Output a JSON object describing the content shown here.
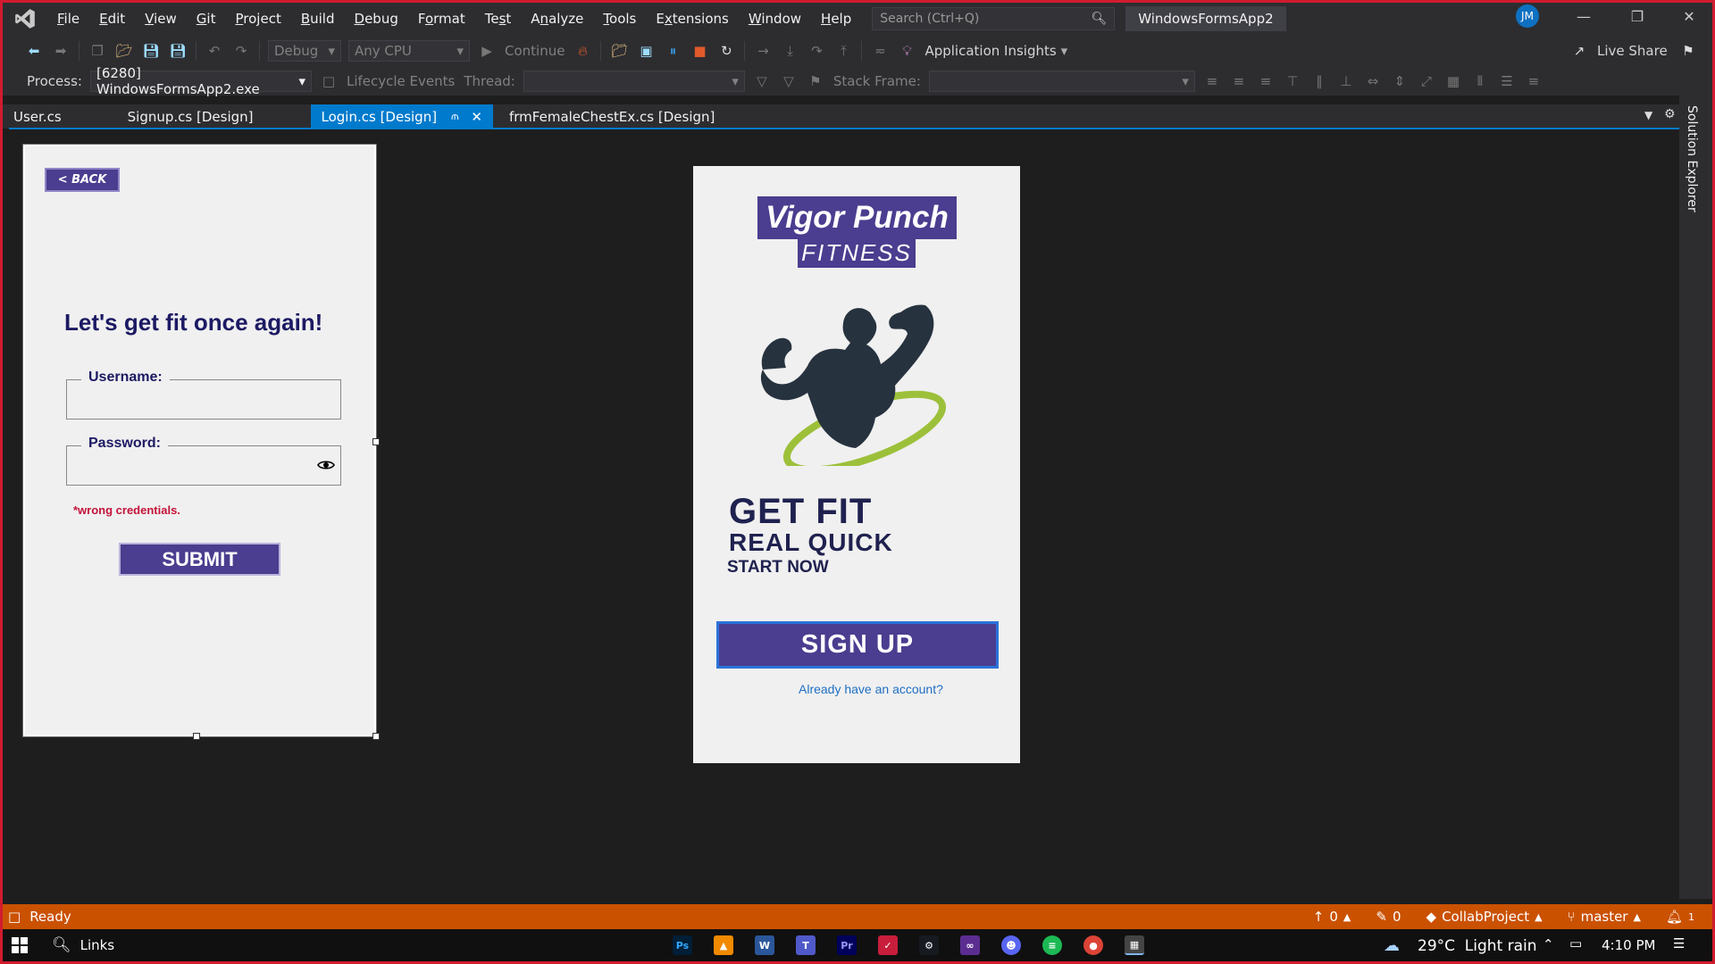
{
  "menubar": {
    "items": [
      "File",
      "Edit",
      "View",
      "Git",
      "Project",
      "Build",
      "Debug",
      "Format",
      "Test",
      "Analyze",
      "Tools",
      "Extensions",
      "Window",
      "Help"
    ],
    "underline": [
      "F",
      "E",
      "V",
      "G",
      "P",
      "B",
      "D",
      "o",
      "s",
      "n",
      "T",
      "x",
      "W",
      "H"
    ],
    "search_placeholder": "Search (Ctrl+Q)",
    "solution_title": "WindowsFormsApp2",
    "avatar_initials": "JM"
  },
  "toolbar": {
    "config": "Debug",
    "platform": "Any CPU",
    "continue_label": "Continue",
    "app_insights_label": "Application Insights",
    "live_share_label": "Live Share",
    "process_label": "Process:",
    "process_value": "[6280] WindowsFormsApp2.exe",
    "lifecycle_label": "Lifecycle Events",
    "thread_label": "Thread:",
    "stack_frame_label": "Stack Frame:"
  },
  "tabs": [
    {
      "label": "User.cs",
      "active": false
    },
    {
      "label": "Signup.cs [Design]",
      "active": false
    },
    {
      "label": "Login.cs [Design]",
      "active": true
    },
    {
      "label": "frmFemaleChestEx.cs [Design]",
      "active": false
    }
  ],
  "side_panel": {
    "label": "Solution Explorer"
  },
  "login_form": {
    "back_label": "< BACK",
    "heading": "Let's get fit once again!",
    "username_label": "Username:",
    "username_value": "",
    "password_label": "Password:",
    "password_value": "",
    "error_text": "*wrong credentials.",
    "submit_label": "SUBMIT"
  },
  "welcome_form": {
    "brand_title": "Vigor Punch",
    "brand_subtitle": "FITNESS",
    "headline": "GET FIT",
    "subheadline": "REAL QUICK",
    "tagline": "START NOW",
    "signup_label": "SIGN UP",
    "login_link": "Already have an account?"
  },
  "statusbar": {
    "status": "Ready",
    "up_count": "0",
    "pencil_count": "0",
    "repo": "CollabProject",
    "branch": "master",
    "notifications": "1"
  },
  "taskbar": {
    "search_label": "Links",
    "weather": "29°C  Light rain",
    "time": "4:10 PM"
  },
  "colors": {
    "accent": "#007acc",
    "brand_purple": "#4b3d8f",
    "status_orange": "#ca5100",
    "error_red": "#c4133a",
    "mascot_dark": "#27323f",
    "mascot_ring": "#9dc03a"
  }
}
